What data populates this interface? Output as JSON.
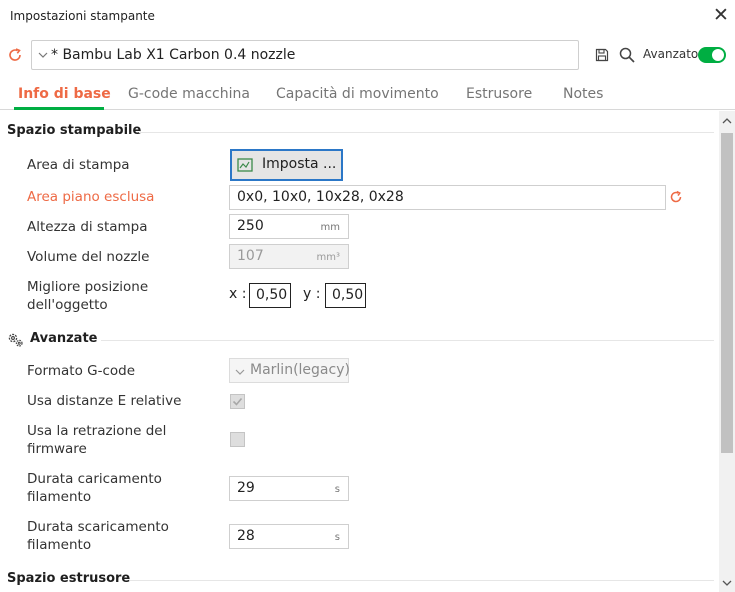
{
  "window": {
    "title": "Impostazioni stampante"
  },
  "preset": {
    "name": "* Bambu Lab X1 Carbon 0.4 nozzle",
    "advanced_label": "Avanzato",
    "advanced_on": true
  },
  "tabs": [
    {
      "label": "Info di base",
      "active": true
    },
    {
      "label": "G-code macchina",
      "active": false
    },
    {
      "label": "Capacità di movimento",
      "active": false
    },
    {
      "label": "Estrusore",
      "active": false
    },
    {
      "label": "Notes",
      "active": false
    }
  ],
  "sections": {
    "printable": "Spazio stampabile",
    "advanced": "Avanzate",
    "extruder": "Spazio estrusore"
  },
  "printable": {
    "area_label": "Area di stampa",
    "area_button": "Imposta ...",
    "excluded_label": "Area piano esclusa",
    "excluded_value": "0x0, 10x0, 10x28, 0x28",
    "height_label": "Altezza di stampa",
    "height_value": "250",
    "height_unit": "mm",
    "nozzle_volume_label": "Volume del nozzle",
    "nozzle_volume_value": "107",
    "nozzle_volume_unit": "mm³",
    "best_pos_label_line1": "Migliore posizione",
    "best_pos_label_line2": "dell'oggetto",
    "best_pos_x_label": "x :",
    "best_pos_x": "0,50",
    "best_pos_y_label": "y :",
    "best_pos_y": "0,50"
  },
  "advanced": {
    "gcode_format_label": "Formato G-code",
    "gcode_format_value": "Marlin(legacy)",
    "relative_e_label": "Usa distanze E relative",
    "relative_e_checked": true,
    "fw_retract_label_line1": "Usa la retrazione del",
    "fw_retract_label_line2": "firmware",
    "fw_retract_checked": false,
    "load_time_label_line1": "Durata caricamento",
    "load_time_label_line2": "filamento",
    "load_time_value": "29",
    "load_time_unit": "s",
    "unload_time_label_line1": "Durata scaricamento",
    "unload_time_label_line2": "filamento",
    "unload_time_value": "28",
    "unload_time_unit": "s"
  },
  "colors": {
    "accent_green": "#00ae42",
    "accent_orange": "#ee6a45",
    "focus_blue": "#2b77c7"
  }
}
